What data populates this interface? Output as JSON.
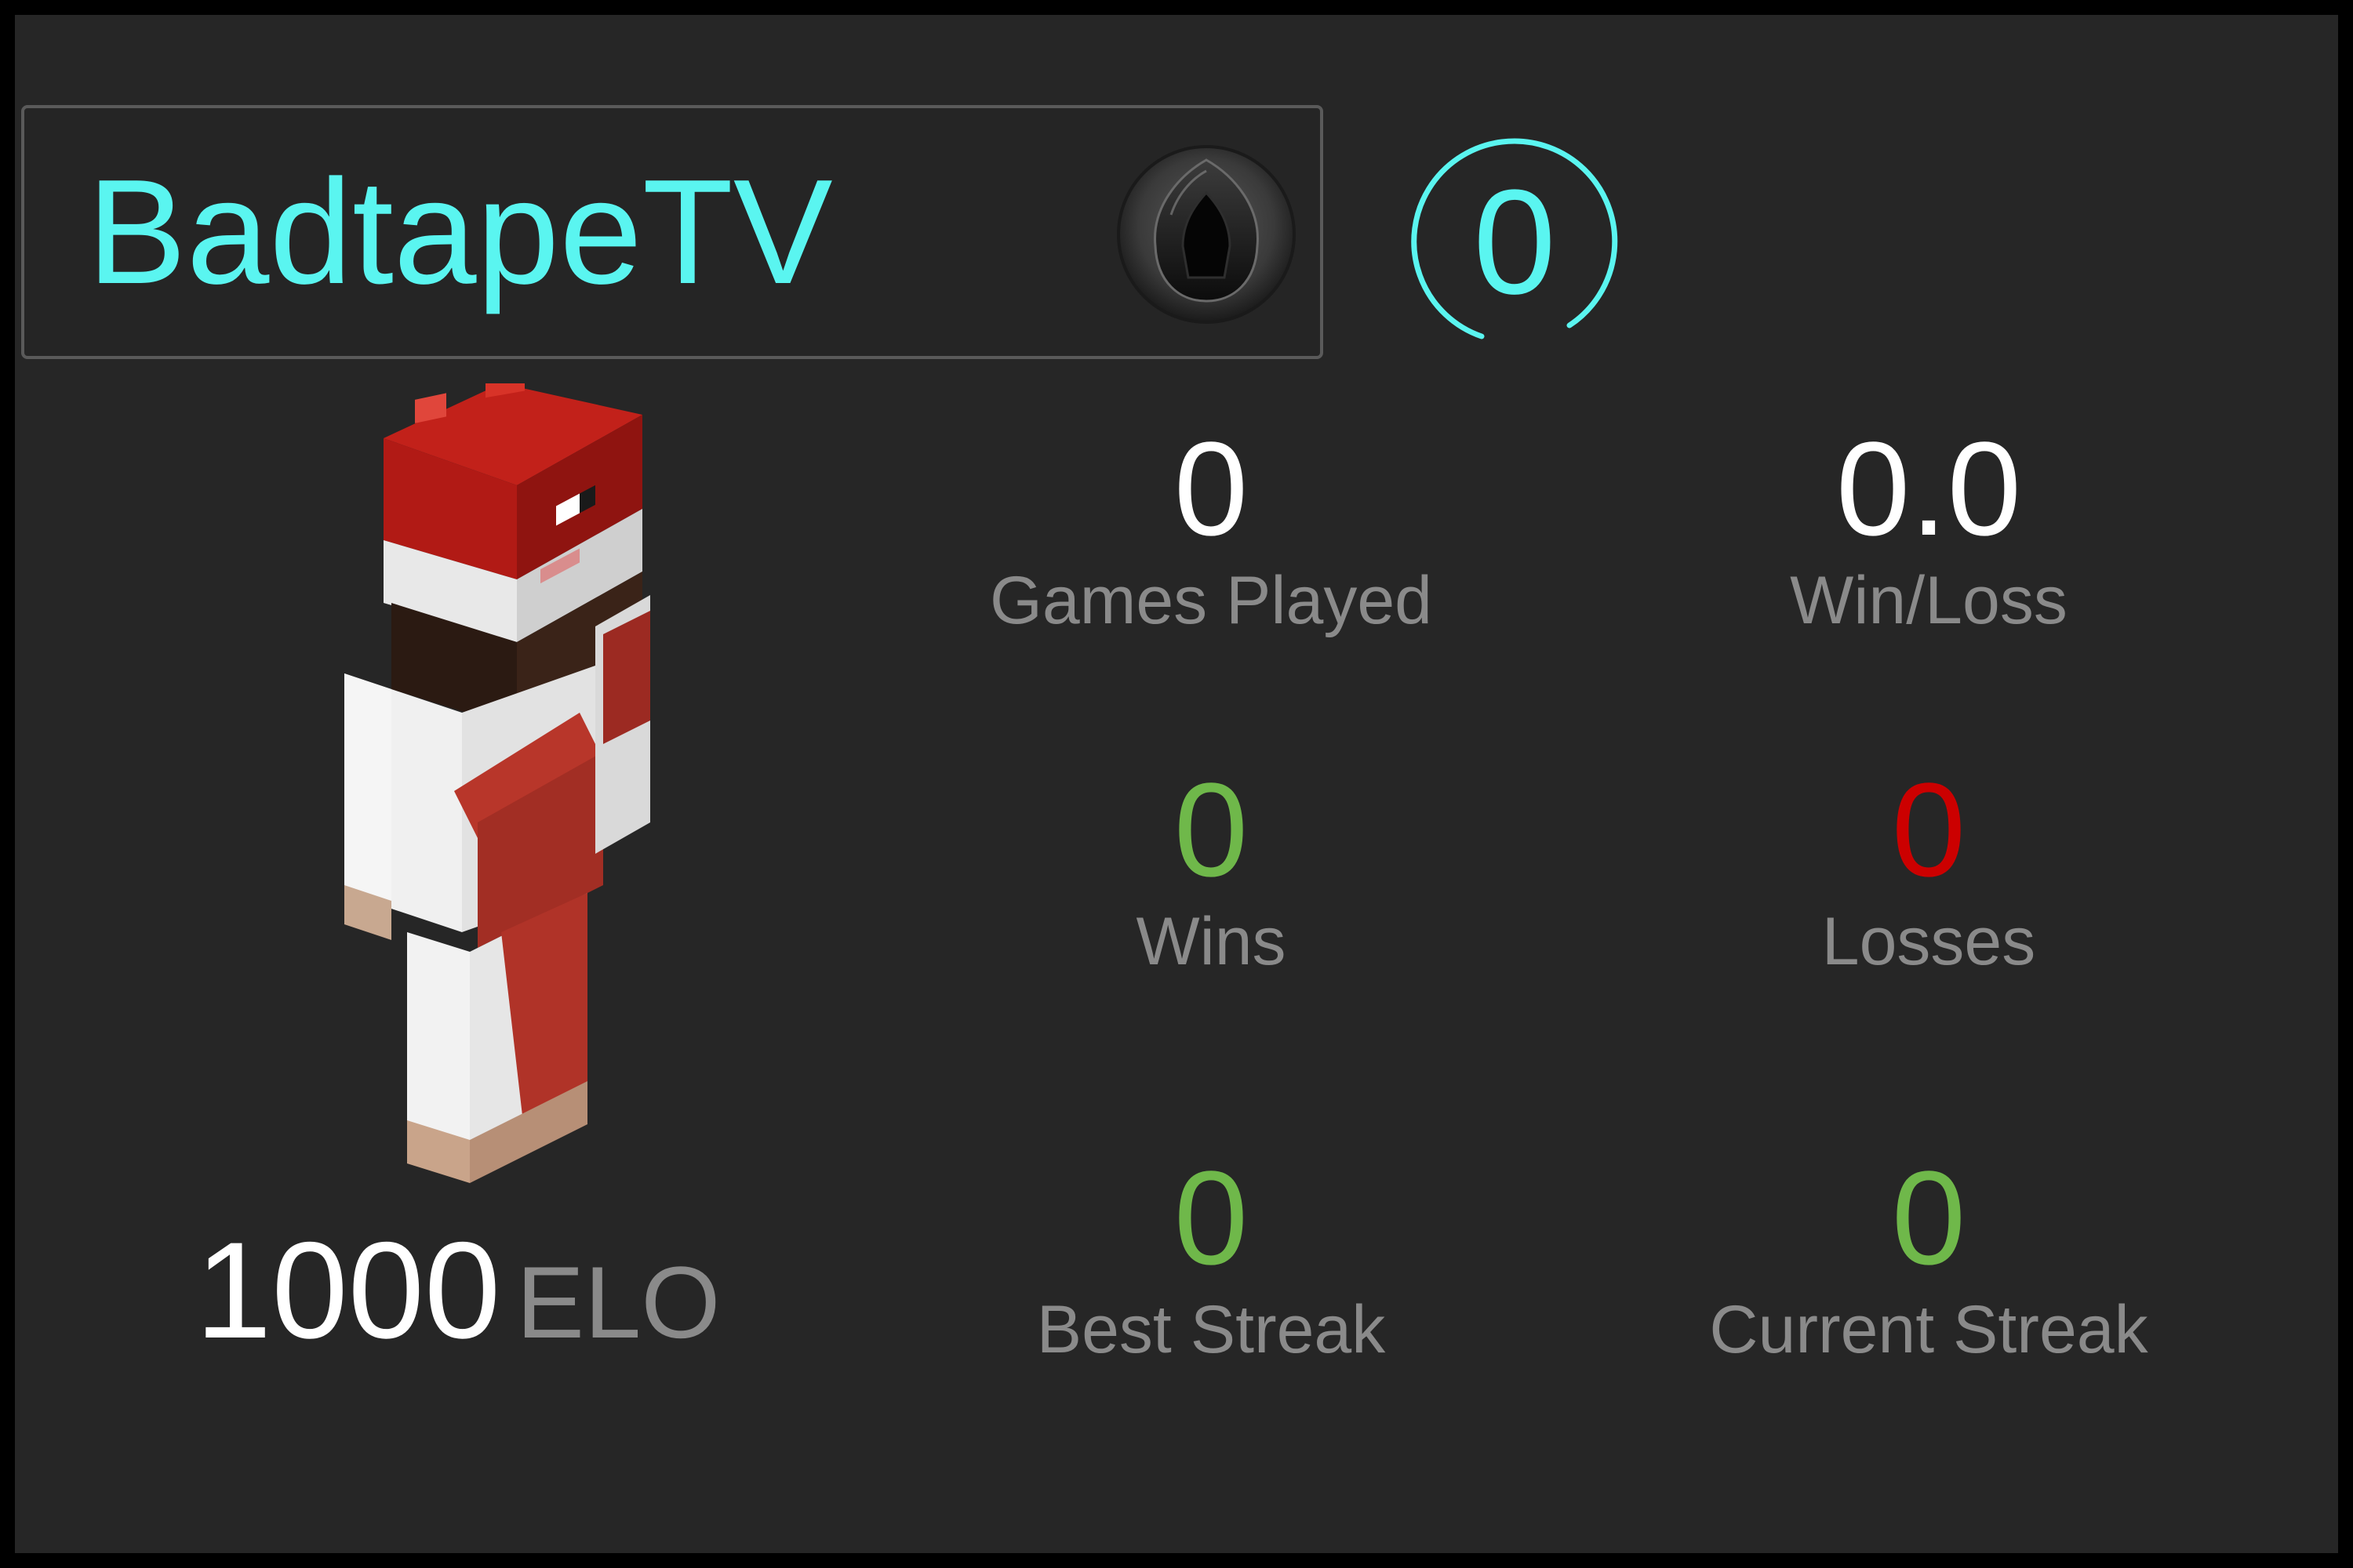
{
  "player": {
    "username": "BadtapeTV",
    "level": "0",
    "elo_value": "1000",
    "elo_unit": "ELO"
  },
  "icons": {
    "rank_badge": "black-gem-rank-icon",
    "skin": "minecraft-santa-skin"
  },
  "colors": {
    "accent": "#5af5f0",
    "positive": "#6fb84a",
    "negative": "#cc0000",
    "label": "#8a8a8a",
    "background": "#262626"
  },
  "stats": {
    "games_played": {
      "value": "0",
      "label": "Games Played"
    },
    "win_loss": {
      "value": "0.0",
      "label": "Win/Loss"
    },
    "wins": {
      "value": "0",
      "label": "Wins"
    },
    "losses": {
      "value": "0",
      "label": "Losses"
    },
    "best_streak": {
      "value": "0",
      "label": "Best Streak"
    },
    "current_streak": {
      "value": "0",
      "label": "Current Streak"
    }
  }
}
